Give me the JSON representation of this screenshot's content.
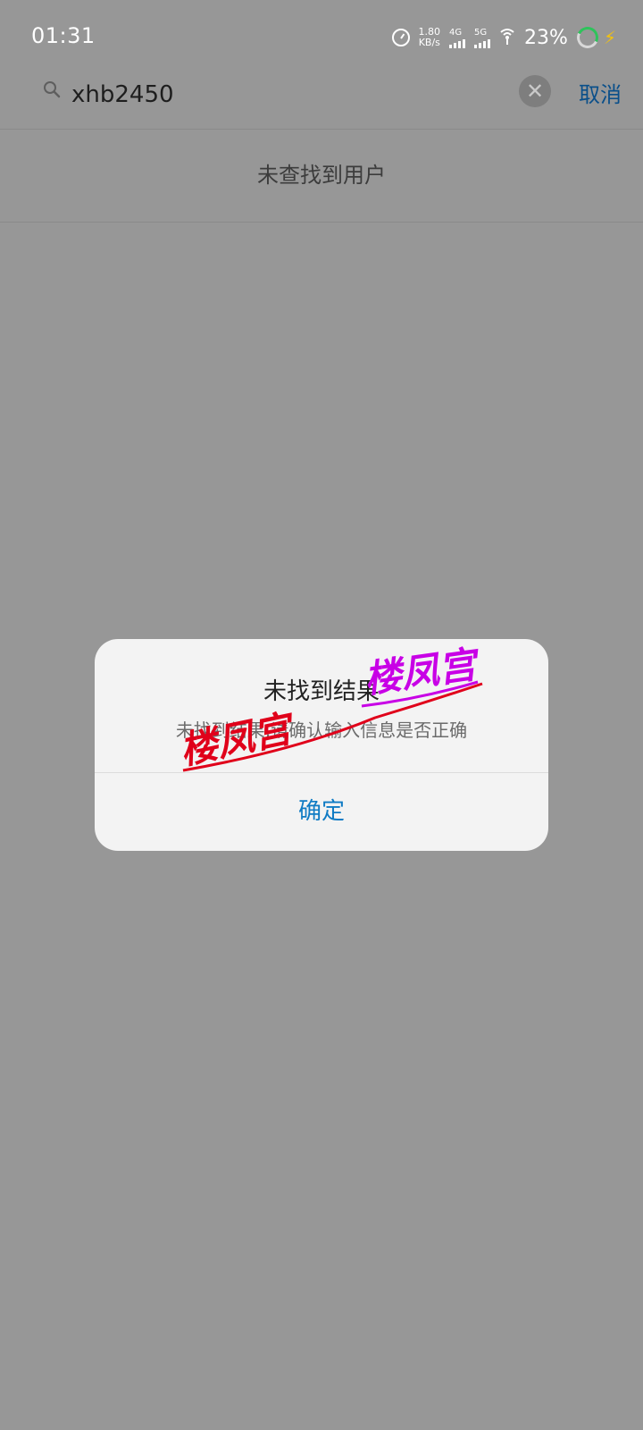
{
  "status_bar": {
    "time": "01:31",
    "speed_value": "1.80",
    "speed_unit": "KB/s",
    "net1": "4G",
    "net2": "5G",
    "battery": "23%"
  },
  "search": {
    "query": "xhb2450",
    "cancel_label": "取消"
  },
  "results": {
    "empty_text": "未查找到用户"
  },
  "dialog": {
    "title": "未找到结果",
    "message": "未找到结果,请确认输入信息是否正确",
    "ok_label": "确定"
  },
  "watermark": {
    "text": "楼凤宫"
  },
  "colors": {
    "overlay_bg": "#979797",
    "link_blue": "#0f7bc4",
    "cancel_blue": "#0a4f8a",
    "watermark_red": "#e0001a",
    "watermark_magenta": "#c800e6"
  }
}
